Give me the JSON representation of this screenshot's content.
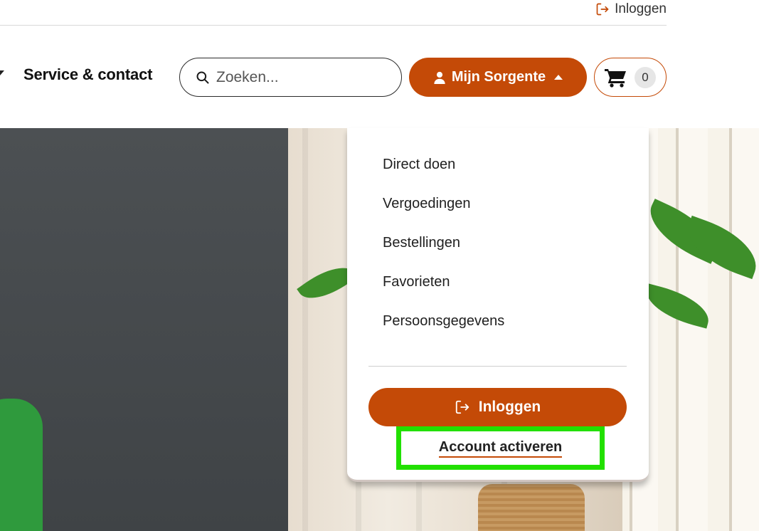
{
  "topbar": {
    "login_label": "Inloggen",
    "login_icon": "sign-in-icon"
  },
  "nav": {
    "service_label": "Service & contact",
    "caret_icon": "chevron-down-icon"
  },
  "search": {
    "placeholder": "Zoeken...",
    "value": "",
    "search_icon": "search-icon",
    "clear_icon": "close-icon"
  },
  "account": {
    "label": "Mijn Sorgente",
    "user_icon": "user-icon",
    "caret_icon": "chevron-up-icon"
  },
  "cart": {
    "icon": "shopping-cart-icon",
    "count": "0"
  },
  "dropdown": {
    "items": [
      {
        "label": "Direct doen"
      },
      {
        "label": "Vergoedingen"
      },
      {
        "label": "Bestellingen"
      },
      {
        "label": "Favorieten"
      },
      {
        "label": "Persoonsgegevens"
      }
    ],
    "login_label": "Inloggen",
    "login_icon": "sign-in-icon",
    "activate_label": "Account activeren"
  },
  "colors": {
    "brand": "#c44a07",
    "highlight": "#22e000",
    "text": "#1a1a1a"
  }
}
